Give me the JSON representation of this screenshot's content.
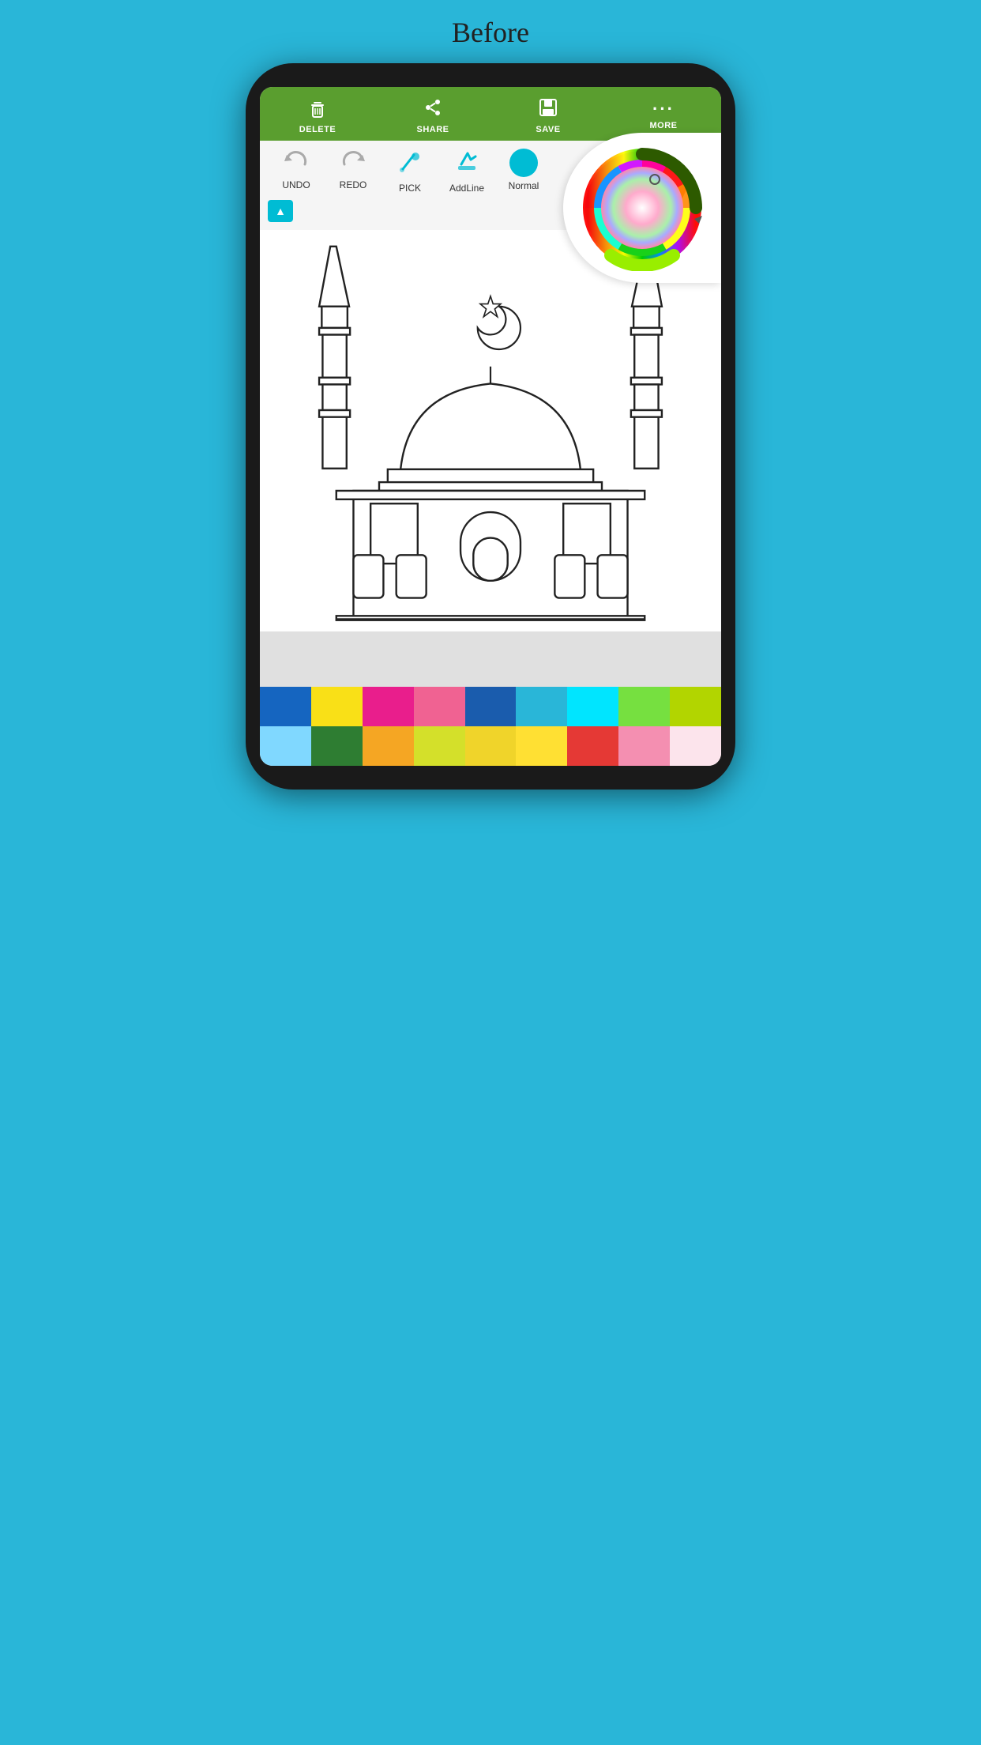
{
  "before_label": "Before",
  "toolbar": {
    "buttons": [
      {
        "id": "delete",
        "label": "DELETE",
        "icon": "🗑"
      },
      {
        "id": "share",
        "label": "SHARE",
        "icon": "⬆"
      },
      {
        "id": "save",
        "label": "SAVE",
        "icon": "💾"
      },
      {
        "id": "more",
        "label": "MORE",
        "icon": "···"
      }
    ]
  },
  "tools": [
    {
      "id": "undo",
      "label": "UNDO",
      "icon": "↩",
      "color": "#aaa"
    },
    {
      "id": "redo",
      "label": "REDO",
      "icon": "↪",
      "color": "#aaa"
    },
    {
      "id": "pick",
      "label": "PICK",
      "icon": "💉",
      "color": "#00bcd4"
    },
    {
      "id": "addline",
      "label": "AddLine",
      "icon": "✏",
      "color": "#00bcd4"
    },
    {
      "id": "normal",
      "label": "Normal",
      "type": "circle",
      "color": "#00bcd4"
    }
  ],
  "palette": {
    "colors_row1": [
      "#1565c0",
      "#f9e017",
      "#e91e8c",
      "#f06292",
      "#1a5cad",
      "#29b6d8",
      "#00bcd4",
      "#76e040",
      "#b2d500",
      "#e65100"
    ],
    "colors_row2": [
      "#80d0f0",
      "#2e7d32",
      "#f5a623",
      "#d4e02a",
      "#f0d42a",
      "#f9e017",
      "#e53935",
      "#f48fb1",
      "#f8bbd0",
      "#f8cdd0"
    ]
  }
}
